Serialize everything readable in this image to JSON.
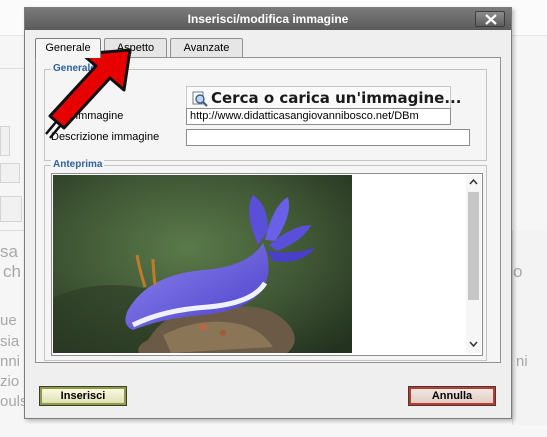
{
  "dialog": {
    "title": "Inserisci/modifica immagine",
    "tabs": [
      {
        "label": "Generale",
        "active": true
      },
      {
        "label": "Aspetto",
        "active": false
      },
      {
        "label": "Avanzate",
        "active": false
      }
    ],
    "general": {
      "legend": "Generale",
      "browse_label": "Cerca o carica un'immagine...",
      "url_label": "URL immagine",
      "url_value": "http://www.didatticasangiovannibosco.net/DBm",
      "description_label": "Descrizione immagine",
      "description_value": ""
    },
    "preview": {
      "legend": "Anteprima"
    },
    "buttons": {
      "insert": "Inserisci",
      "cancel": "Annulla"
    }
  },
  "background": {
    "fragments": [
      "sa",
      "ch",
      "ue",
      "sia",
      "nni",
      "zio",
      "ouls",
      "o",
      "ni"
    ]
  },
  "icons": {
    "close": "close-icon",
    "search": "magnifier-icon",
    "annotation": "red-arrow-icon"
  },
  "colors": {
    "titlebar": "#5b5b5b",
    "legend": "#2f6098",
    "insert_border": "#8e9c3c",
    "cancel_border": "#c0392b",
    "arrow": "#e60000"
  }
}
